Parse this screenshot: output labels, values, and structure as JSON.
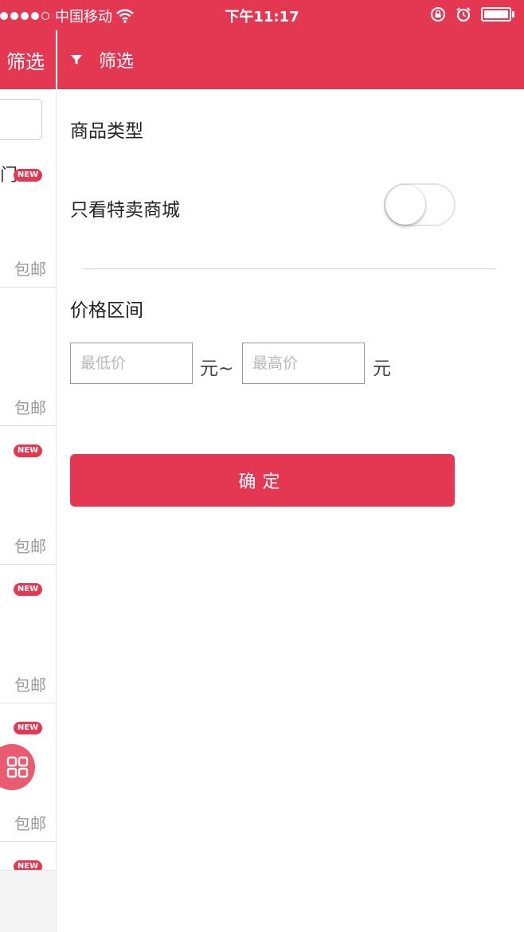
{
  "status_bar": {
    "carrier": "中国移动",
    "time": "下午11:17"
  },
  "left_page": {
    "header_title": "筛选",
    "first_item_text": "门",
    "new_badge": "NEW",
    "free_shipping": "包邮"
  },
  "panel": {
    "header_title": "筛选",
    "product_type_label": "商品类型",
    "special_mall_label": "只看特卖商城",
    "special_mall_toggle_on": false,
    "price_range_label": "价格区间",
    "min_price_placeholder": "最低价",
    "max_price_placeholder": "最高价",
    "unit_yuan": "元",
    "unit_yuan_tilde": "元~",
    "confirm_label": "确定"
  },
  "colors": {
    "accent": "#e33752",
    "fab": "#e95b70"
  },
  "icons": {
    "filter": "filter-icon",
    "grid": "grid-icon",
    "wifi": "wifi-icon",
    "battery": "battery-icon",
    "alarm": "alarm-icon",
    "rotation_lock": "rotation-lock-icon"
  }
}
